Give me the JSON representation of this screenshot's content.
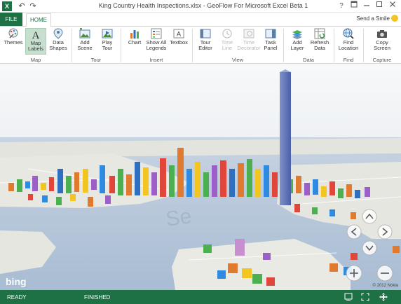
{
  "window": {
    "app_icon": "X",
    "title": "King Country Health Inspections.xlsx - GeoFlow For Microsoft Excel Beta 1",
    "controls": [
      "?",
      "restore-icon",
      "minimize-icon",
      "maximize-icon",
      "close-icon"
    ]
  },
  "tabs": {
    "file": "FILE",
    "home": "HOME",
    "send_smile": "Send a Smile"
  },
  "ribbon": {
    "groups": {
      "map": "Map",
      "tour": "Tour",
      "insert": "Insert",
      "view": "View",
      "data": "Data",
      "find": "Find",
      "capture": "Capture"
    },
    "buttons": {
      "themes": "Themes",
      "map_labels": "Map\nLabels",
      "data_shapes": "Data\nShapes",
      "add_scene": "Add\nScene",
      "play_tour": "Play\nTour",
      "chart": "Chart",
      "show_all_legends": "Show All\nLegends",
      "textbox": "Textbox",
      "tour_editor": "Tour\nEditor",
      "time_line": "Time\nLine",
      "time_decorator": "Time\nDecorator",
      "task_panel": "Task\nPanel",
      "add_layer": "Add\nLayer",
      "refresh_data": "Refresh\nData",
      "find_location": "Find\nLocation",
      "copy_screen": "Copy\nScreen"
    }
  },
  "map": {
    "logo": "bing",
    "copyright": "© 2012 Nokia",
    "street_label": "Se"
  },
  "status": {
    "ready": "READY",
    "finished": "FINISHED"
  },
  "colors": {
    "excel_green": "#1e7145",
    "active_button": "#c7dfcf",
    "water": "#b7c8dc",
    "land": "#e8e8e2",
    "sky": "#f4f6f8"
  }
}
